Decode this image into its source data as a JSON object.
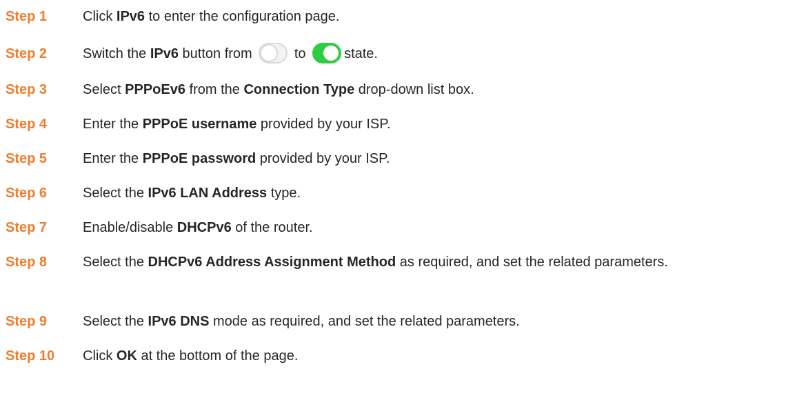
{
  "steps": [
    {
      "label": "Step 1",
      "segments": [
        "Click ",
        "IPv6",
        " to enter the configuration page."
      ]
    },
    {
      "label": "Step 2",
      "segments": [
        "Switch the ",
        "IPv6",
        " button from ",
        " to ",
        "state."
      ]
    },
    {
      "label": "Step 3",
      "segments": [
        "Select ",
        "PPPoEv6",
        " from the ",
        "Connection Type",
        " drop-down list box."
      ]
    },
    {
      "label": "Step 4",
      "segments": [
        "Enter the ",
        "PPPoE username",
        " provided by your ISP."
      ]
    },
    {
      "label": "Step 5",
      "segments": [
        "Enter the ",
        "PPPoE password",
        " provided by your ISP."
      ]
    },
    {
      "label": "Step 6",
      "segments": [
        "Select the ",
        "IPv6 LAN Address",
        " type."
      ]
    },
    {
      "label": "Step 7",
      "segments": [
        "Enable/disable ",
        "DHCPv6",
        " of the router."
      ]
    },
    {
      "label": "Step 8",
      "segments": [
        "Select the ",
        "DHCPv6 Address Assignment Method",
        " as required, and set the related parameters."
      ]
    },
    {
      "label": "Step 9",
      "segments": [
        "Select the ",
        "IPv6 DNS",
        " mode as required, and set the related parameters."
      ]
    },
    {
      "label": "Step 10",
      "segments": [
        "Click ",
        "OK",
        " at the bottom of the page."
      ]
    }
  ],
  "colors": {
    "step_label": "#ED7D31",
    "body_text": "#262626",
    "toggle_on": "#2ecc40",
    "toggle_off_border": "#d9d9d9"
  },
  "icons": {
    "toggle_off": "toggle-off-icon",
    "toggle_on": "toggle-on-icon"
  }
}
